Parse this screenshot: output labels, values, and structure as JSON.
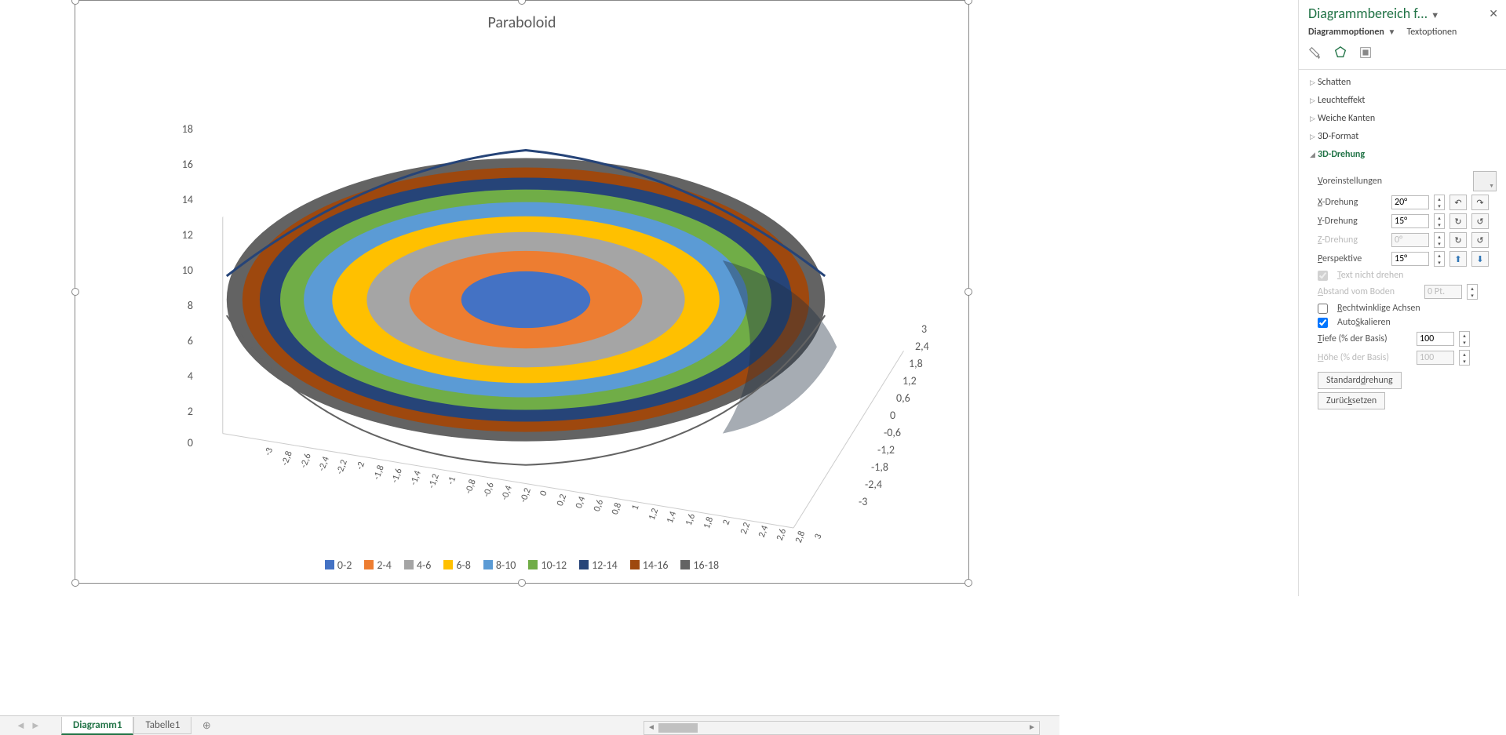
{
  "chart_data": {
    "type": "surface",
    "title": "Paraboloid",
    "x_values": [
      -3,
      -2.8,
      -2.6,
      -2.4,
      -2.2,
      -2,
      -1.8,
      -1.6,
      -1.4,
      -1.2,
      -1,
      -0.8,
      -0.6,
      -0.4,
      -0.2,
      0,
      0.2,
      0.4,
      0.6,
      0.8,
      1,
      1.2,
      1.4,
      1.6,
      1.8,
      2,
      2.2,
      2.4,
      2.6,
      2.8,
      3
    ],
    "y_values": [
      -3,
      -2.4,
      -1.8,
      -1.2,
      -0.6,
      0,
      0.6,
      1.2,
      1.8,
      2.4,
      3
    ],
    "z_ticks": [
      0,
      2,
      4,
      6,
      8,
      10,
      12,
      14,
      16,
      18
    ],
    "y_ticks_shown": [
      3,
      2.4,
      1.8,
      1.2,
      0.6,
      0,
      -0.6,
      -1.2,
      -1.8,
      -2.4,
      -3
    ],
    "legend": [
      "0-2",
      "2-4",
      "4-6",
      "6-8",
      "8-10",
      "10-12",
      "12-14",
      "14-16",
      "16-18"
    ],
    "legend_colors": [
      "#4472C4",
      "#ED7D31",
      "#A5A5A5",
      "#FFC000",
      "#5B9BD5",
      "#70AD47",
      "#264478",
      "#9E480E",
      "#636363"
    ],
    "zlabel": "",
    "xlabel": "",
    "ylabel": ""
  },
  "pane": {
    "title": "Diagrammbereich f...",
    "tab_options": "Diagrammoptionen",
    "tab_text": "Textoptionen",
    "sections": {
      "shadow": "Schatten",
      "glow": "Leuchteffekt",
      "soft": "Weiche Kanten",
      "format3d": "3D-Format",
      "rot3d": "3D-Drehung"
    },
    "presets_label": "Voreinstellungen",
    "x_rot_label": "X-Drehung",
    "x_rot": "20°",
    "y_rot_label": "Y-Drehung",
    "y_rot": "15°",
    "z_rot_label": "Z-Drehung",
    "z_rot": "0°",
    "persp_label": "Perspektive",
    "persp": "15°",
    "keep_text": "Text nicht drehen",
    "dist_label": "Abstand vom Boden",
    "dist_val": "0 Pt.",
    "right_angle": "Rechtwinklige Achsen",
    "autoscale": "AutoSkalieren",
    "depth_label": "Tiefe (% der Basis)",
    "depth_val": "100",
    "height_label": "Höhe (% der Basis)",
    "height_val": "100",
    "btn_default": "Standarddrehung",
    "btn_reset": "Zurücksetzen"
  },
  "sheets": {
    "active": "Diagramm1",
    "other": "Tabelle1"
  }
}
